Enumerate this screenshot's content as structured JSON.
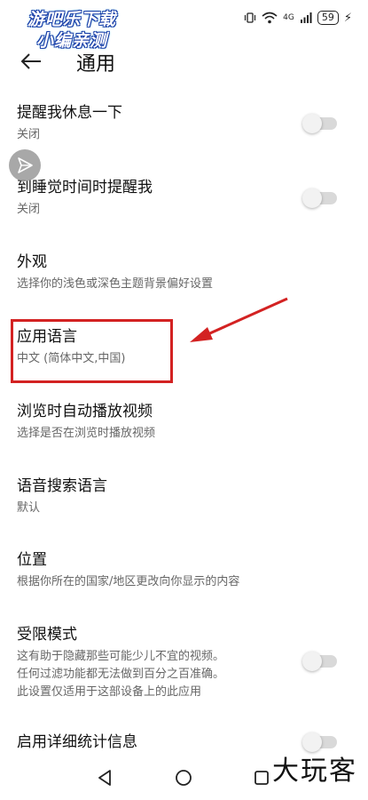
{
  "watermark_top": [
    "游吧乐下载",
    "小编亲测"
  ],
  "status_bar": {
    "battery": "59",
    "network": "4G"
  },
  "header": {
    "title": "通用"
  },
  "settings": [
    {
      "title": "提醒我休息一下",
      "subtitle": "关闭",
      "toggle": "off"
    },
    {
      "title": "到睡觉时间时提醒我",
      "subtitle": "关闭",
      "toggle": "off"
    },
    {
      "title": "外观",
      "subtitle": "选择你的浅色或深色主题背景偏好设置"
    },
    {
      "title": "应用语言",
      "subtitle": "中文 (简体中文,中国)"
    },
    {
      "title": "浏览时自动播放视频",
      "subtitle": "选择是否在浏览时播放视频"
    },
    {
      "title": "语音搜索语言",
      "subtitle": "默认"
    },
    {
      "title": "位置",
      "subtitle": "根据你所在的国家/地区更改向你显示的内容"
    },
    {
      "title": "受限模式",
      "subtitle_lines": [
        "这有助于隐藏那些可能少儿不宜的视频。",
        "任何过滤功能都无法做到百分之百准确。",
        "此设置仅适用于这部设备上的此应用"
      ],
      "toggle": "off"
    },
    {
      "title": "启用详细统计信息",
      "toggle": "off"
    }
  ],
  "watermark_bottom": "大玩客",
  "colors": {
    "highlight": "#d32222",
    "toggle_track": "#d9d9d9"
  }
}
